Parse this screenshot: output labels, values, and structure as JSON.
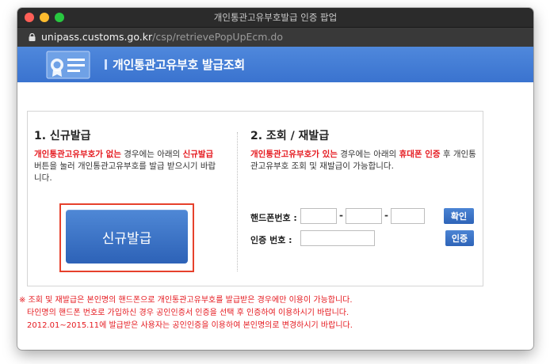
{
  "window": {
    "title": "개인통관고유부호발급 인증 팝업"
  },
  "address_bar": {
    "host": "unipass.customs.go.kr",
    "path": "/csp/retrievePopUpEcm.do"
  },
  "header": {
    "title": "개인통관고유부호 발급조회"
  },
  "new_issue": {
    "title": "1. 신규발급",
    "desc_red1": "개인통관고유부호가 없는",
    "desc_text1": " 경우에는 아래의 ",
    "desc_red2": "신규발급",
    "desc_text2": " 버튼을 눌러 개인통관고유부호를 발급 받으시기 바랍니다.",
    "button_label": "신규발급"
  },
  "reissue": {
    "title": "2. 조회 / 재발급",
    "desc_red1": "개인통관고유부호가 있는",
    "desc_text1": " 경우에는 아래의 ",
    "desc_red2": "휴대폰 인증",
    "desc_text2": " 후 개인통관고유부호 조회 및 재발급이 가능합니다.",
    "phone_label": "핸드폰번호 :",
    "dash": "-",
    "confirm_label": "확인",
    "auth_label": "인증 번호 :",
    "auth_button": "인증"
  },
  "notes": [
    "※ 조회 및 재발급은 본인명의 핸드폰으로 개인통관고유부호를 발급받은 경우에만 이용이 가능합니다.",
    "타인명의 핸드폰 번호로 가입하신 경우 공인인증서 인증을 선택 후 인증하여 이용하시기 바랍니다.",
    "2012.01~2015.11에 발급받은 사용자는 공인인증을 이용하여 본인명의로 변경하시기 바랍니다."
  ],
  "colors": {
    "accent": "#3a73cf",
    "alert": "#e5191f",
    "highlight_border": "#e6412c"
  }
}
